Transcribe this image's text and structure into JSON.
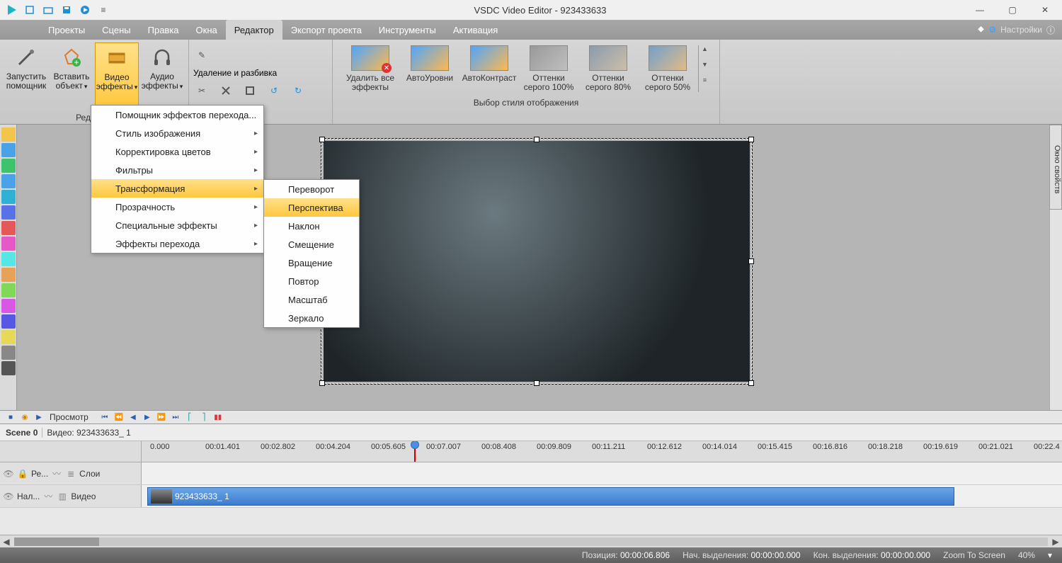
{
  "title": "VSDC Video Editor - 923433633",
  "settings_label": "Настройки",
  "menu_tabs": [
    "Проекты",
    "Сцены",
    "Правка",
    "Окна",
    "Редактор",
    "Экспорт проекта",
    "Инструменты",
    "Активация"
  ],
  "active_tab": "Редактор",
  "ribbon": {
    "group_edit_caption": "Редактир",
    "launch_helper": "Запустить помощник",
    "insert_object": "Вставить объект",
    "video_effects": "Видео эффекты",
    "audio_effects": "Аудио эффекты",
    "delete_split": "Удаление и разбивка",
    "style_caption": "Выбор стиля отображения",
    "styles": [
      {
        "label": "Удалить все эффекты"
      },
      {
        "label": "АвтоУровни"
      },
      {
        "label": "АвтоКонтраст"
      },
      {
        "label": "Оттенки серого 100%"
      },
      {
        "label": "Оттенки серого 80%"
      },
      {
        "label": "Оттенки серого 50%"
      }
    ]
  },
  "video_effects_menu": [
    {
      "label": "Помощник эффектов перехода...",
      "arrow": false
    },
    {
      "label": "Стиль изображения",
      "arrow": true
    },
    {
      "label": "Корректировка цветов",
      "arrow": true
    },
    {
      "label": "Фильтры",
      "arrow": true
    },
    {
      "label": "Трансформация",
      "arrow": true,
      "highlight": true
    },
    {
      "label": "Прозрачность",
      "arrow": true
    },
    {
      "label": "Специальные эффекты",
      "arrow": true
    },
    {
      "label": "Эффекты перехода",
      "arrow": true
    }
  ],
  "transform_submenu": [
    {
      "label": "Переворот"
    },
    {
      "label": "Перспектива",
      "highlight": true
    },
    {
      "label": "Наклон"
    },
    {
      "label": "Смещение"
    },
    {
      "label": "Вращение"
    },
    {
      "label": "Повтор"
    },
    {
      "label": "Масштаб"
    },
    {
      "label": "Зеркало"
    }
  ],
  "right_panel": "Окно свойств",
  "playback_label": "Просмотр",
  "scene_header": {
    "scene": "Scene 0",
    "clip": "Видео: 923433633_ 1"
  },
  "ruler_times": [
    "0.000",
    "00:01.401",
    "00:02.802",
    "00:04.204",
    "00:05.605",
    "00:07.007",
    "00:08.408",
    "00:09.809",
    "00:11.211",
    "00:12.612",
    "00:14.014",
    "00:15.415",
    "00:16.816",
    "00:18.218",
    "00:19.619",
    "00:21.021",
    "00:22.4"
  ],
  "track_rows": [
    {
      "name": "Ре...",
      "extra": "Слои"
    },
    {
      "name": "Нал...",
      "extra": "Видео"
    }
  ],
  "clip_name": "923433633_ 1",
  "status": {
    "pos_label": "Позиция:",
    "pos_val": "00:00:06.806",
    "selstart_label": "Нач. выделения:",
    "selstart_val": "00:00:00.000",
    "selend_label": "Кон. выделения:",
    "selend_val": "00:00:00.000",
    "zoom_label": "Zoom To Screen",
    "zoom_val": "40%"
  }
}
